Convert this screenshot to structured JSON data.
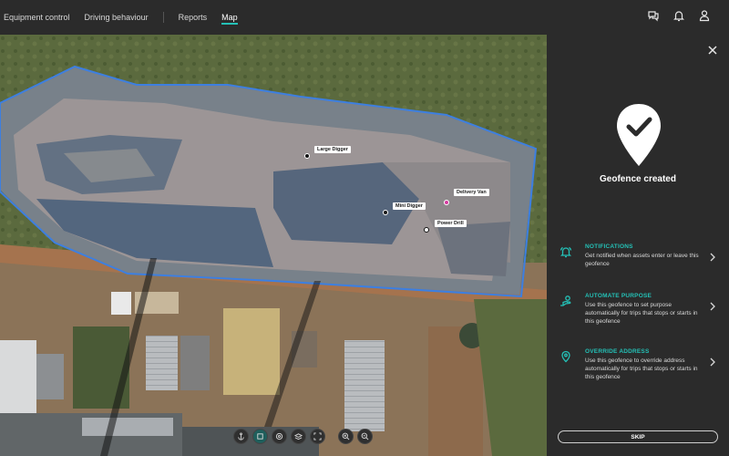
{
  "nav": {
    "items": [
      {
        "label": "Equipment control",
        "active": false
      },
      {
        "label": "Driving behaviour",
        "active": false
      },
      {
        "label": "Reports",
        "active": false
      },
      {
        "label": "Map",
        "active": true
      }
    ],
    "icons": [
      "chat-icon",
      "bell-icon",
      "user-icon"
    ]
  },
  "map": {
    "assets": [
      {
        "label": "Large Digger"
      },
      {
        "label": "Delivery Van"
      },
      {
        "label": "Mini Digger"
      },
      {
        "label": "Power Drill"
      }
    ],
    "toolbar_icons": [
      "anchor-icon",
      "polygon-icon",
      "layers-icon",
      "stack-icon",
      "fullscreen-icon",
      "zoom-in-icon",
      "zoom-out-icon"
    ],
    "geofence_color": "#3d7fe0"
  },
  "panel": {
    "title": "Geofence created",
    "options": [
      {
        "title": "NOTIFICATIONS",
        "description": "Get notified when assets enter or leave this geofence",
        "icon": "bell-icon"
      },
      {
        "title": "AUTOMATE PURPOSE",
        "description": "Use this geofence to set purpose automatically for trips that stops or starts in this geofence",
        "icon": "purpose-icon"
      },
      {
        "title": "OVERRIDE ADDRESS",
        "description": "Use this geofence to override address automatically for trips that stops or starts in this geofence",
        "icon": "location-pin-icon"
      }
    ],
    "skip_label": "SKIP",
    "accent_color": "#24c0b6"
  }
}
